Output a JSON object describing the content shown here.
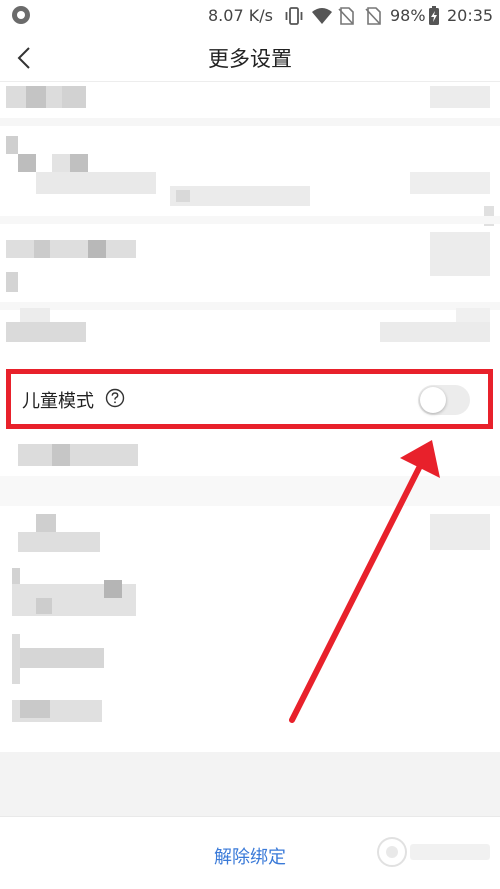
{
  "status_bar": {
    "net_speed": "8.07 K/s",
    "battery": "98%",
    "time": "20:35",
    "icons": [
      "notification-dot-icon",
      "vibrate-icon",
      "wifi-icon",
      "no-sim-icon",
      "no-sim-icon",
      "battery-charging-icon"
    ]
  },
  "header": {
    "back_icon": "chevron-left-icon",
    "title": "更多设置"
  },
  "settings": {
    "child_mode": {
      "label": "儿童模式",
      "help_icon": "question-circle-icon",
      "enabled": false
    }
  },
  "footer": {
    "unbind_label": "解除绑定"
  },
  "annotation": {
    "highlight_color": "#e8212b",
    "arrow_color": "#e8212b"
  },
  "colors": {
    "link_blue": "#3a7ad8",
    "toggle_off": "#ececec"
  }
}
